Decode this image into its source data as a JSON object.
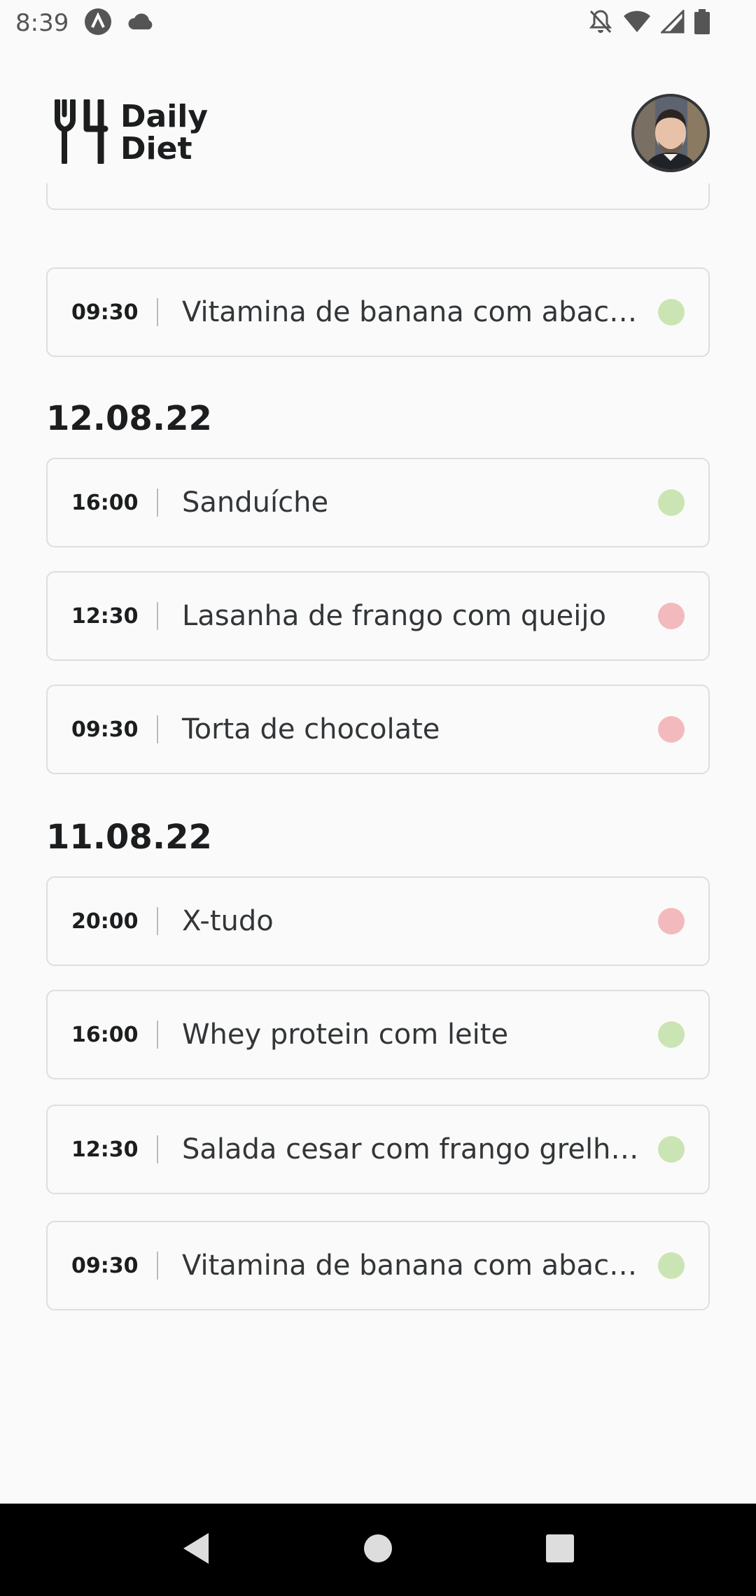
{
  "status_bar": {
    "time": "8:39",
    "icons": [
      "app-notification-icon",
      "cloud-icon",
      "do-not-disturb-icon",
      "wifi-icon",
      "signal-icon",
      "battery-icon"
    ]
  },
  "header": {
    "logo_line1": "Daily",
    "logo_line2": "Diet"
  },
  "colors": {
    "within_diet": "#CBE4B4",
    "off_diet": "#F3BABD",
    "card_border": "#DDDEDF"
  },
  "sections": [
    {
      "date": "",
      "meals": [
        {
          "time": "",
          "name": "",
          "status": "in"
        },
        {
          "time": "09:30",
          "name": "Vitamina de banana com abacate",
          "status": "in"
        }
      ]
    },
    {
      "date": "12.08.22",
      "meals": [
        {
          "time": "16:00",
          "name": "Sanduíche",
          "status": "in"
        },
        {
          "time": "12:30",
          "name": "Lasanha de frango com queijo",
          "status": "out"
        },
        {
          "time": "09:30",
          "name": "Torta de chocolate",
          "status": "out"
        }
      ]
    },
    {
      "date": "11.08.22",
      "meals": [
        {
          "time": "20:00",
          "name": "X-tudo",
          "status": "out"
        },
        {
          "time": "16:00",
          "name": "Whey protein com leite",
          "status": "in"
        },
        {
          "time": "12:30",
          "name": "Salada cesar com frango grelhado",
          "status": "in"
        },
        {
          "time": "09:30",
          "name": "Vitamina de banana com abacate",
          "status": "in"
        }
      ]
    }
  ],
  "nav_bar": {
    "buttons": [
      "back-icon",
      "home-icon",
      "recents-icon"
    ]
  }
}
